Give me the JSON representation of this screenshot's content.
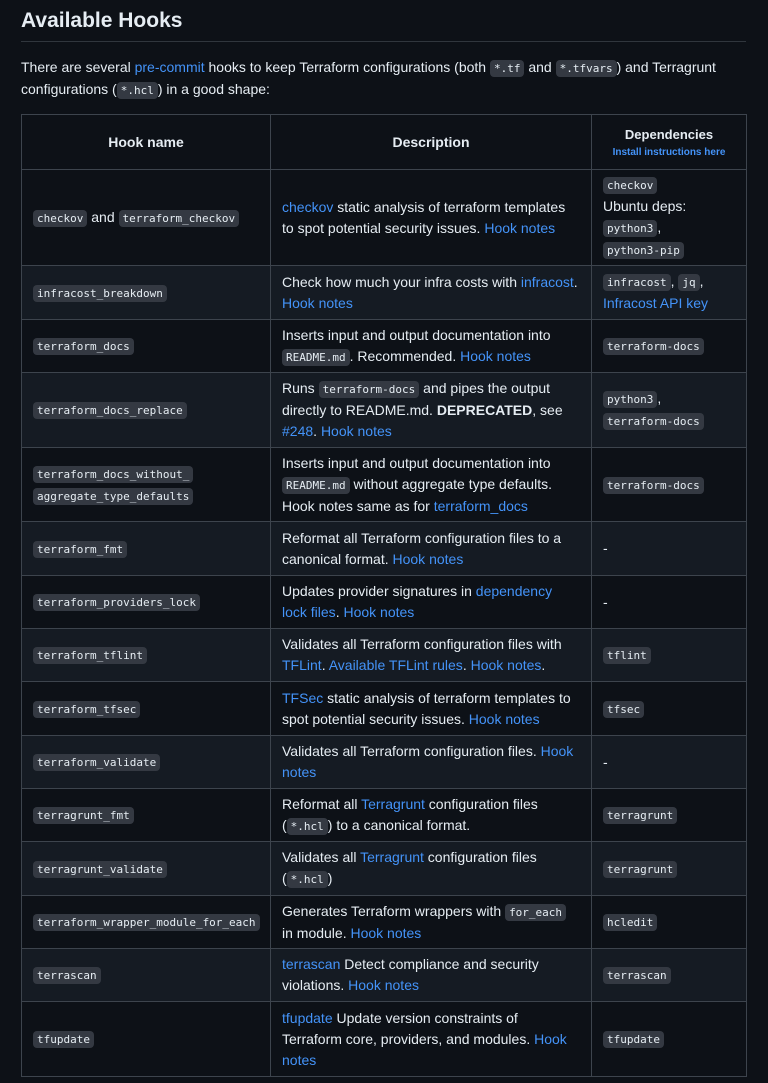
{
  "heading": "Available Hooks",
  "intro": {
    "p1": "There are several ",
    "link": "pre-commit",
    "p2": " hooks to keep Terraform configurations (both ",
    "code1": "*.tf",
    "p3": " and ",
    "code2": "*.tfvars",
    "p4": ") and Terragrunt configurations (",
    "code3": "*.hcl",
    "p5": ") in a good shape:"
  },
  "table": {
    "headers": {
      "hook": "Hook name",
      "desc": "Description",
      "deps": "Dependencies",
      "deps_link": "Install instructions here"
    },
    "rows": [
      {
        "hook": [
          "checkov",
          " and ",
          "terraform_checkov"
        ],
        "desc": [
          {
            "t": "link",
            "v": "checkov"
          },
          {
            "t": "text",
            "v": " static analysis of terraform templates to spot potential security issues. "
          },
          {
            "t": "link",
            "v": "Hook notes"
          }
        ],
        "deps": [
          {
            "t": "code",
            "v": "checkov"
          },
          {
            "t": "br"
          },
          {
            "t": "text",
            "v": "Ubuntu deps: "
          },
          {
            "t": "code",
            "v": "python3"
          },
          {
            "t": "text",
            "v": ", "
          },
          {
            "t": "code",
            "v": "python3-pip"
          }
        ]
      },
      {
        "hook": [
          "infracost_breakdown"
        ],
        "desc": [
          {
            "t": "text",
            "v": "Check how much your infra costs with "
          },
          {
            "t": "link",
            "v": "infracost"
          },
          {
            "t": "text",
            "v": ". "
          },
          {
            "t": "link",
            "v": "Hook notes"
          }
        ],
        "deps": [
          {
            "t": "code",
            "v": "infracost"
          },
          {
            "t": "text",
            "v": ", "
          },
          {
            "t": "code",
            "v": "jq"
          },
          {
            "t": "text",
            "v": ", "
          },
          {
            "t": "link",
            "v": "Infracost API key"
          }
        ]
      },
      {
        "hook": [
          "terraform_docs"
        ],
        "desc": [
          {
            "t": "text",
            "v": "Inserts input and output documentation into "
          },
          {
            "t": "code",
            "v": "README.md"
          },
          {
            "t": "text",
            "v": ". Recommended. "
          },
          {
            "t": "link",
            "v": "Hook notes"
          }
        ],
        "deps": [
          {
            "t": "code",
            "v": "terraform-docs"
          }
        ]
      },
      {
        "hook": [
          "terraform_docs_replace"
        ],
        "desc": [
          {
            "t": "text",
            "v": "Runs "
          },
          {
            "t": "code",
            "v": "terraform-docs"
          },
          {
            "t": "text",
            "v": " and pipes the output directly to README.md. "
          },
          {
            "t": "bold",
            "v": "DEPRECATED"
          },
          {
            "t": "text",
            "v": ", see "
          },
          {
            "t": "link",
            "v": "#248"
          },
          {
            "t": "text",
            "v": ". "
          },
          {
            "t": "link",
            "v": "Hook notes"
          }
        ],
        "deps": [
          {
            "t": "code",
            "v": "python3"
          },
          {
            "t": "text",
            "v": ", "
          },
          {
            "t": "code",
            "v": "terraform-docs"
          }
        ]
      },
      {
        "hook": [
          "terraform_docs_without_",
          "aggregate_type_defaults"
        ],
        "desc": [
          {
            "t": "text",
            "v": "Inserts input and output documentation into "
          },
          {
            "t": "code",
            "v": "README.md"
          },
          {
            "t": "text",
            "v": " without aggregate type defaults. Hook notes same as for "
          },
          {
            "t": "link",
            "v": "terraform_docs"
          }
        ],
        "deps": [
          {
            "t": "code",
            "v": "terraform-docs"
          }
        ]
      },
      {
        "hook": [
          "terraform_fmt"
        ],
        "desc": [
          {
            "t": "text",
            "v": "Reformat all Terraform configuration files to a canonical format. "
          },
          {
            "t": "link",
            "v": "Hook notes"
          }
        ],
        "deps": [
          {
            "t": "text",
            "v": "-"
          }
        ]
      },
      {
        "hook": [
          "terraform_providers_lock"
        ],
        "desc": [
          {
            "t": "text",
            "v": "Updates provider signatures in "
          },
          {
            "t": "link",
            "v": "dependency lock files"
          },
          {
            "t": "text",
            "v": ". "
          },
          {
            "t": "link",
            "v": "Hook notes"
          }
        ],
        "deps": [
          {
            "t": "text",
            "v": "-"
          }
        ]
      },
      {
        "hook": [
          "terraform_tflint"
        ],
        "desc": [
          {
            "t": "text",
            "v": "Validates all Terraform configuration files with "
          },
          {
            "t": "link",
            "v": "TFLint"
          },
          {
            "t": "text",
            "v": ". "
          },
          {
            "t": "link",
            "v": "Available TFLint rules"
          },
          {
            "t": "text",
            "v": ". "
          },
          {
            "t": "link",
            "v": "Hook notes"
          },
          {
            "t": "text",
            "v": "."
          }
        ],
        "deps": [
          {
            "t": "code",
            "v": "tflint"
          }
        ]
      },
      {
        "hook": [
          "terraform_tfsec"
        ],
        "desc": [
          {
            "t": "link",
            "v": "TFSec"
          },
          {
            "t": "text",
            "v": " static analysis of terraform templates to spot potential security issues. "
          },
          {
            "t": "link",
            "v": "Hook notes"
          }
        ],
        "deps": [
          {
            "t": "code",
            "v": "tfsec"
          }
        ]
      },
      {
        "hook": [
          "terraform_validate"
        ],
        "desc": [
          {
            "t": "text",
            "v": "Validates all Terraform configuration files. "
          },
          {
            "t": "link",
            "v": "Hook notes"
          }
        ],
        "deps": [
          {
            "t": "text",
            "v": "-"
          }
        ]
      },
      {
        "hook": [
          "terragrunt_fmt"
        ],
        "desc": [
          {
            "t": "text",
            "v": "Reformat all "
          },
          {
            "t": "link",
            "v": "Terragrunt"
          },
          {
            "t": "text",
            "v": " configuration files ("
          },
          {
            "t": "code",
            "v": "*.hcl"
          },
          {
            "t": "text",
            "v": ") to a canonical format."
          }
        ],
        "deps": [
          {
            "t": "code",
            "v": "terragrunt"
          }
        ]
      },
      {
        "hook": [
          "terragrunt_validate"
        ],
        "desc": [
          {
            "t": "text",
            "v": "Validates all "
          },
          {
            "t": "link",
            "v": "Terragrunt"
          },
          {
            "t": "text",
            "v": " configuration files ("
          },
          {
            "t": "code",
            "v": "*.hcl"
          },
          {
            "t": "text",
            "v": ")"
          }
        ],
        "deps": [
          {
            "t": "code",
            "v": "terragrunt"
          }
        ]
      },
      {
        "hook": [
          "terraform_wrapper_module_for_each"
        ],
        "desc": [
          {
            "t": "text",
            "v": "Generates Terraform wrappers with "
          },
          {
            "t": "code",
            "v": "for_each"
          },
          {
            "t": "text",
            "v": " in module. "
          },
          {
            "t": "link",
            "v": "Hook notes"
          }
        ],
        "deps": [
          {
            "t": "code",
            "v": "hcledit"
          }
        ]
      },
      {
        "hook": [
          "terrascan"
        ],
        "desc": [
          {
            "t": "link",
            "v": "terrascan"
          },
          {
            "t": "text",
            "v": " Detect compliance and security violations. "
          },
          {
            "t": "link",
            "v": "Hook notes"
          }
        ],
        "deps": [
          {
            "t": "code",
            "v": "terrascan"
          }
        ]
      },
      {
        "hook": [
          "tfupdate"
        ],
        "desc": [
          {
            "t": "link",
            "v": "tfupdate"
          },
          {
            "t": "text",
            "v": " Update version constraints of Terraform core, providers, and modules. "
          },
          {
            "t": "link",
            "v": "Hook notes"
          }
        ],
        "deps": [
          {
            "t": "code",
            "v": "tfupdate"
          }
        ]
      }
    ]
  }
}
